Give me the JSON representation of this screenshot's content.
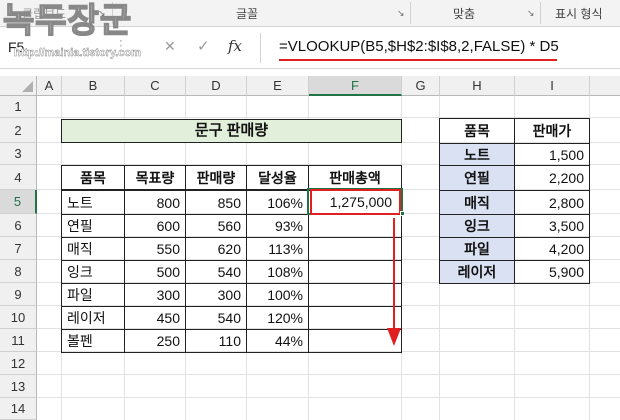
{
  "ribbon": {
    "groups": [
      {
        "label": "클립보드"
      },
      {
        "label": "글꼴"
      },
      {
        "label": "맞춤"
      },
      {
        "label": "표시 형식"
      }
    ],
    "launcher_glyph": "↘",
    "watermark_title": "녹두장군",
    "watermark_url": "http://mainia.tistory.com"
  },
  "formula_bar": {
    "name_box": "F5",
    "cancel_glyph": "✕",
    "enter_glyph": "✓",
    "fx_label": "fx",
    "formula": "=VLOOKUP(B5,$H$2:$I$8,2,FALSE) * D5",
    "highlight_color": "#e02020"
  },
  "sheet": {
    "columns": [
      "A",
      "B",
      "C",
      "D",
      "E",
      "F",
      "G",
      "H",
      "I"
    ],
    "rows": [
      "1",
      "2",
      "3",
      "4",
      "5",
      "6",
      "7",
      "8",
      "9",
      "10",
      "11",
      "12",
      "13",
      "14"
    ],
    "selected_cell": "F5",
    "main_table": {
      "title": "문구 판매량",
      "title_fill": "#e2efda",
      "headers": [
        "품목",
        "목표량",
        "판매량",
        "달성율",
        "판매총액"
      ],
      "rows": [
        [
          "노트",
          "800",
          "850",
          "106%",
          "1,275,000"
        ],
        [
          "연필",
          "600",
          "560",
          "93%",
          ""
        ],
        [
          "매직",
          "550",
          "620",
          "113%",
          ""
        ],
        [
          "잉크",
          "500",
          "540",
          "108%",
          ""
        ],
        [
          "파일",
          "300",
          "300",
          "100%",
          ""
        ],
        [
          "레이저",
          "450",
          "540",
          "120%",
          ""
        ],
        [
          "볼펜",
          "250",
          "110",
          "44%",
          ""
        ]
      ]
    },
    "lookup_table": {
      "header_fill": "#d9e1f2",
      "headers": [
        "품목",
        "판매가"
      ],
      "rows": [
        [
          "노트",
          "1,500"
        ],
        [
          "연필",
          "2,200"
        ],
        [
          "매직",
          "2,800"
        ],
        [
          "잉크",
          "3,500"
        ],
        [
          "파일",
          "4,200"
        ],
        [
          "레이저",
          "5,900"
        ]
      ]
    },
    "annotation_color": "#e02020"
  }
}
